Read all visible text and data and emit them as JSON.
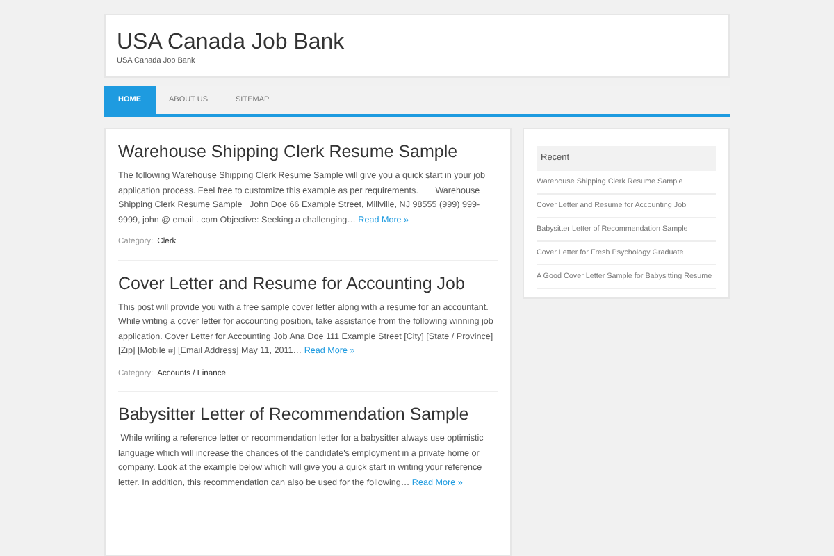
{
  "site": {
    "title": "USA Canada Job Bank",
    "tagline": "USA Canada Job Bank"
  },
  "nav": [
    {
      "label": "HOME",
      "selected": true
    },
    {
      "label": "ABOUT US",
      "selected": false
    },
    {
      "label": "SITEMAP",
      "selected": false
    }
  ],
  "posts": [
    {
      "title": "Warehouse Shipping Clerk Resume Sample",
      "excerpt": "The following Warehouse Shipping Clerk Resume Sample will give you a quick start in your job application process. Feel free to customize this example as per requirements.       Warehouse Shipping Clerk Resume Sample   John Doe 66 Example Street, Millville, NJ 98555 (999) 999-9999, john @ email . com Objective: Seeking a challenging…",
      "read_more": "Read More »",
      "category_label": "Category:",
      "category": "Clerk"
    },
    {
      "title": "Cover Letter and Resume for Accounting Job",
      "excerpt": "This post will provide you with a free sample cover letter along with a resume for an accountant. While writing a cover letter for accounting position, take assistance from the following winning job application. Cover Letter for Accounting Job Ana Doe 111 Example Street [City] [State / Province] [Zip] [Mobile #] [Email Address] May 11, 2011…",
      "read_more": "Read More »",
      "category_label": "Category:",
      "category": "Accounts / Finance"
    },
    {
      "title": "Babysitter Letter of Recommendation Sample",
      "excerpt": " While writing a reference letter or recommendation letter for a babysitter always use optimistic language which will increase the chances of the candidate's employment in a private home or company. Look at the example below which will give you a quick start in writing your reference letter. In addition, this recommendation can also be used for the following…",
      "read_more": "Read More »"
    }
  ],
  "sidebar": {
    "title": "Recent",
    "items": [
      "Warehouse Shipping Clerk Resume Sample",
      "Cover Letter and Resume for Accounting Job",
      "Babysitter Letter of Recommendation Sample",
      "Cover Letter for Fresh Psychology Graduate",
      "A Good Cover Letter Sample for Babysitting Resume"
    ]
  }
}
